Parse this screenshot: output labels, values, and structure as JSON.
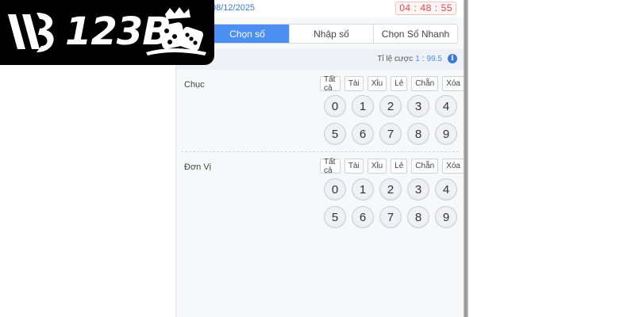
{
  "header": {
    "date": "08/12/2025",
    "timer": {
      "hh": "04",
      "mm": "48",
      "ss": "55"
    }
  },
  "tabs": [
    {
      "label": "Chọn số",
      "active": true
    },
    {
      "label": "Nhập số",
      "active": false
    },
    {
      "label": "Chọn Số Nhanh",
      "active": false
    }
  ],
  "rate": {
    "label": "Tỉ lệ cược",
    "value": "1",
    "sep": ":",
    "odds": "99.5",
    "icon": "info-icon"
  },
  "sections": [
    {
      "label": "Chục",
      "filters": [
        "Tất cả",
        "Tài",
        "Xỉu",
        "Lẻ",
        "Chẵn",
        "Xóa"
      ],
      "numbers": [
        "0",
        "1",
        "2",
        "3",
        "4",
        "5",
        "6",
        "7",
        "8",
        "9"
      ]
    },
    {
      "label": "Đơn Vị",
      "filters": [
        "Tất cả",
        "Tài",
        "Xỉu",
        "Lẻ",
        "Chẵn",
        "Xóa"
      ],
      "numbers": [
        "0",
        "1",
        "2",
        "3",
        "4",
        "5",
        "6",
        "7",
        "8",
        "9"
      ]
    }
  ],
  "logo": {
    "text": "123B"
  },
  "colors": {
    "accent": "#4b8ff2",
    "timer": "#e24b4b",
    "logo_bg": "#000000"
  }
}
